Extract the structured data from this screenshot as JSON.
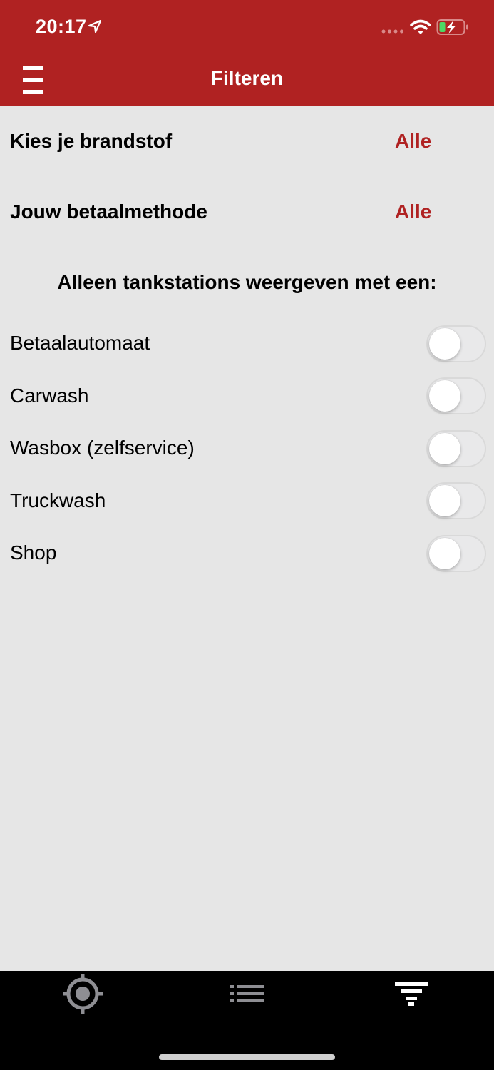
{
  "status_bar": {
    "time": "20:17"
  },
  "header": {
    "title": "Filteren"
  },
  "filters": {
    "fuel": {
      "label": "Kies je brandstof",
      "value": "Alle"
    },
    "payment": {
      "label": "Jouw betaalmethode",
      "value": "Alle"
    }
  },
  "section": {
    "heading": "Alleen tankstations weergeven met een:"
  },
  "toggles": [
    {
      "label": "Betaalautomaat",
      "on": false
    },
    {
      "label": "Carwash",
      "on": false
    },
    {
      "label": "Wasbox (zelfservice)",
      "on": false
    },
    {
      "label": "Truckwash",
      "on": false
    },
    {
      "label": "Shop",
      "on": false
    }
  ],
  "tabbar": {
    "tabs": [
      {
        "icon": "locate-icon",
        "active": false
      },
      {
        "icon": "list-icon",
        "active": false
      },
      {
        "icon": "filter-icon",
        "active": true
      }
    ]
  },
  "colors": {
    "brand": "#b02222",
    "background": "#e6e6e6",
    "tabbar": "#000000"
  }
}
